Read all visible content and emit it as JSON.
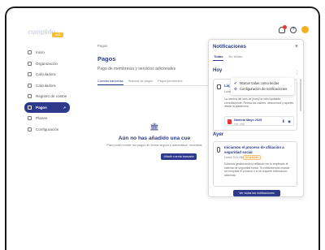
{
  "app": {
    "logo_text": "cumplido",
    "logo_badge": "2.0"
  },
  "sidebar": {
    "items": [
      {
        "label": "Inicio"
      },
      {
        "label": "Organización"
      },
      {
        "label": "Calculadora"
      },
      {
        "label": "Calculadora"
      },
      {
        "label": "Registro de costos"
      },
      {
        "label": "Pagos",
        "active": true
      },
      {
        "label": "Planes"
      },
      {
        "label": "Configuración"
      }
    ]
  },
  "main": {
    "breadcrumb": "Pagos",
    "title": "Pagos",
    "subtitle": "Pago de membresía y servicios adicionales",
    "tabs": [
      "Cuentas bancarias",
      "Historial de pagos",
      "Pagos pendientes"
    ],
    "empty_title": "Aún no has añadido una cue",
    "empty_desc": "Para poder recibir tus pagos de forma segura y automática, necesitas",
    "add_button": "Añadir cuenta bancaria"
  },
  "notifications": {
    "title": "Notificaciones",
    "tabs": [
      "Todas",
      "No leídas"
    ],
    "today_label": "Hoy",
    "yesterday_label": "Ayer",
    "menu": {
      "mark_all": "Marcar todas como leídas",
      "settings": "Configuración de notificaciones"
    },
    "card1": {
      "title": "Liq",
      "date": "Lunes",
      "body": "La nómina del mes de [mes] ha sido liquidada correctamente. Revisa los valores, descuentos y aportes desde la plataforma.",
      "file_name": "Nómina Mayo 2025",
      "file_size": "PDF 2MB"
    },
    "card2": {
      "title": "Iniciamos el proceso de afiliación a seguridad social",
      "date": "Lunes 9:11 AM",
      "status": "En proceso",
      "body": "Estamos gestionando la afiliación de tu empleado al sistema de seguridad social. Te notificaremos cuando se complete el proceso o si se requiere información adicional."
    },
    "see_all": "Ver todas las notificaciones"
  }
}
